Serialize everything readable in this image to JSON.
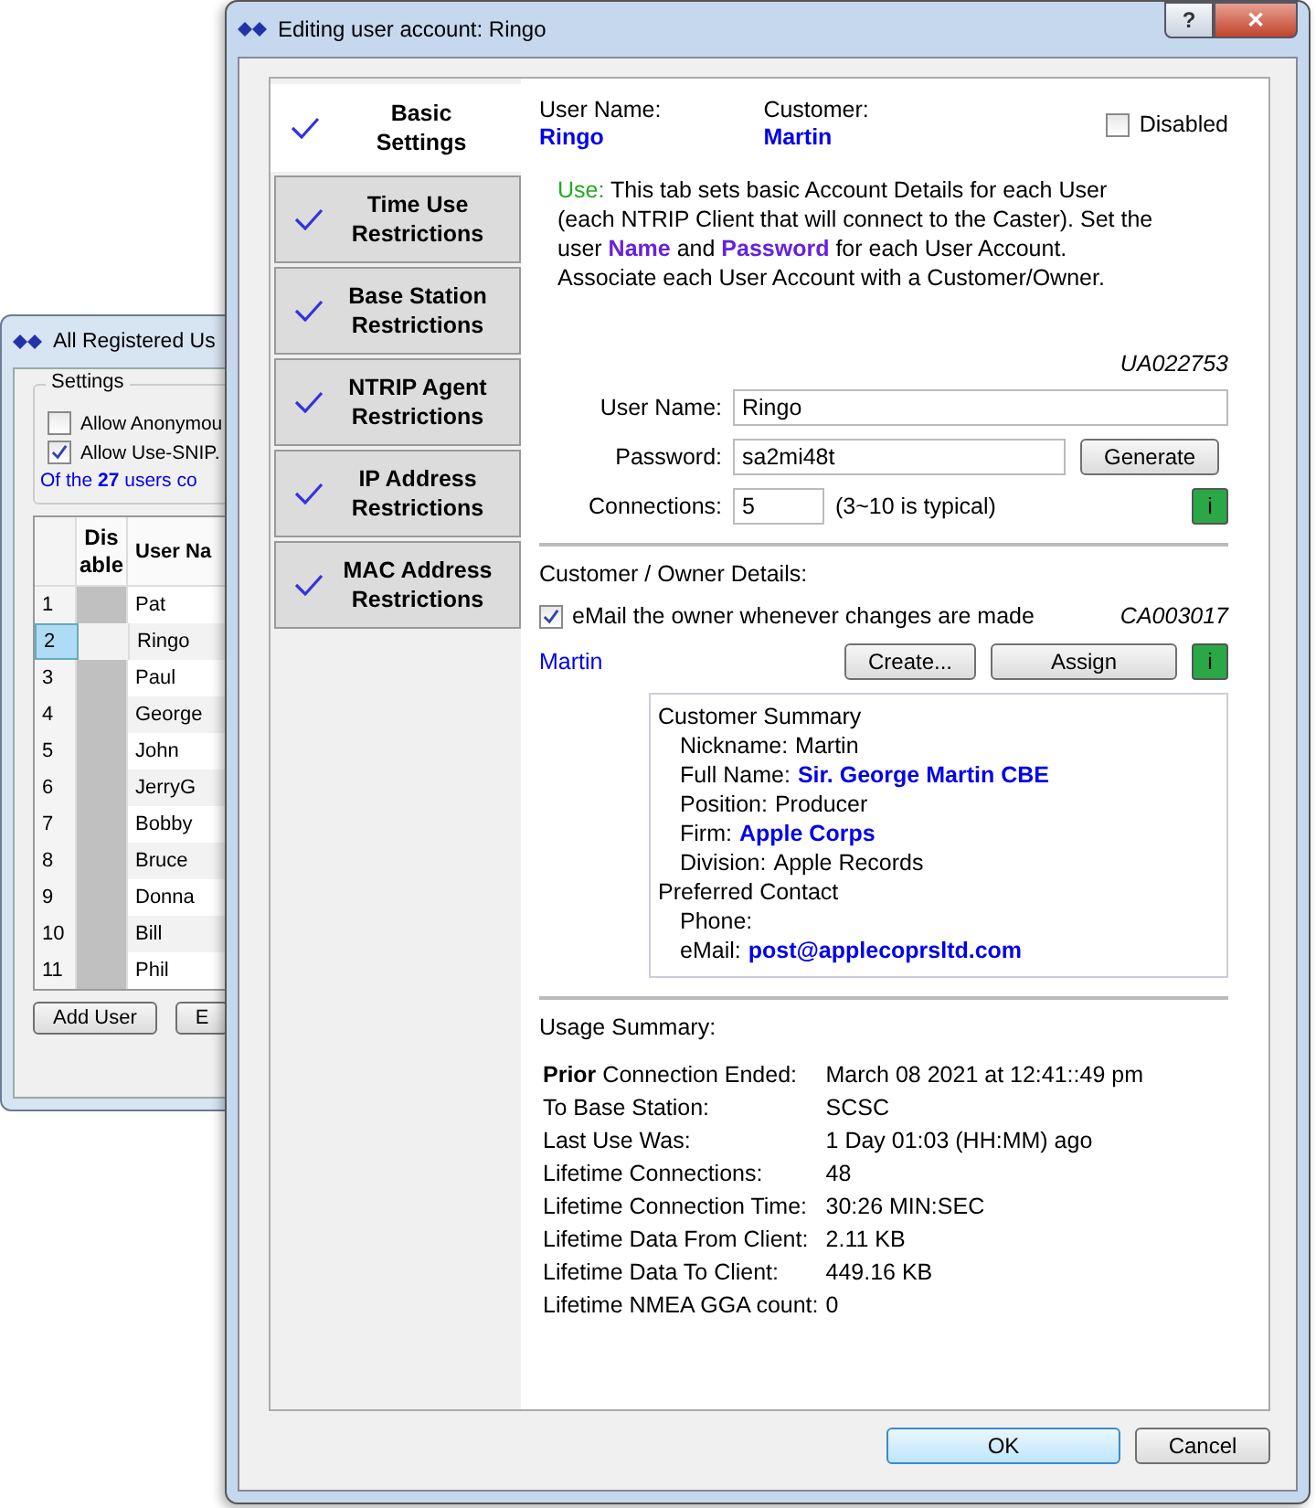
{
  "background_window": {
    "title": "All Registered Us",
    "settings": {
      "title": "Settings",
      "options": [
        {
          "label": "Allow Anonymou",
          "checked": false
        },
        {
          "label": "Allow Use-SNIP.",
          "checked": true
        }
      ],
      "note": "Of the **27** users co"
    },
    "table": {
      "columns": [
        "",
        "Dis able",
        "User Na"
      ],
      "rows": [
        {
          "number": "1",
          "name": "Pat",
          "selected": false
        },
        {
          "number": "2",
          "name": "Ringo",
          "selected": true
        },
        {
          "number": "3",
          "name": "Paul",
          "selected": false
        },
        {
          "number": "4",
          "name": "George",
          "selected": false
        },
        {
          "number": "5",
          "name": "John",
          "selected": false
        },
        {
          "number": "6",
          "name": "JerryG",
          "selected": false
        },
        {
          "number": "7",
          "name": "Bobby",
          "selected": false
        },
        {
          "number": "8",
          "name": "Bruce",
          "selected": false
        },
        {
          "number": "9",
          "name": "Donna",
          "selected": false
        },
        {
          "number": "10",
          "name": "Bill",
          "selected": false
        },
        {
          "number": "11",
          "name": "Phil",
          "selected": false
        }
      ]
    },
    "buttons": [
      "Add User",
      "E"
    ]
  },
  "dialog": {
    "title": "Editing user account: Ringo",
    "title_buttons": [
      "?",
      "✕"
    ],
    "tabs": [
      {
        "label": "Basic Settings",
        "selected": true,
        "checked": true
      },
      {
        "label": "Time Use Restrictions",
        "selected": false,
        "checked": true
      },
      {
        "label": "Base Station Restrictions",
        "selected": false,
        "checked": true
      },
      {
        "label": "NTRIP Agent Restrictions",
        "selected": false,
        "checked": true
      },
      {
        "label": "IP Address Restrictions",
        "selected": false,
        "checked": true
      },
      {
        "label": "MAC Address Restrictions",
        "selected": false,
        "checked": true
      }
    ],
    "header": [
      {
        "label": "User Name:",
        "value": "Ringo"
      },
      {
        "label": "Customer:",
        "value": "Martin"
      }
    ],
    "disabled": {
      "label": "Disabled",
      "checked": false
    },
    "intro": {
      "lead": "Use:",
      "text": "This tab sets basic Account Details for each User (each NTRIP Client that will connect to the Caster). Set the user **Name** and **Password** for each User Account. Associate each User Account with a Customer/Owner."
    },
    "account_id": "UA022753",
    "fields": [
      {
        "kind": "text",
        "label": "User Name:",
        "value": "Ringo"
      },
      {
        "kind": "password",
        "label": "Password:",
        "value": "sa2mi48t",
        "button": "Generate"
      },
      {
        "kind": "number",
        "label": "Connections:",
        "value": "5",
        "hint": "(3~10 is typical)",
        "info": "i"
      }
    ],
    "owner": {
      "title": "Customer / Owner Details:",
      "email_option": {
        "label": "eMail the owner whenever changes are made",
        "checked": true
      },
      "customer_id": "CA003017",
      "customer_link": "Martin",
      "buttons": [
        "Create...",
        "Assign"
      ],
      "info": "i",
      "summary": [
        {
          "title": "Customer Summary",
          "children": [
            {
              "label": "Nickname:",
              "value": "Martin",
              "emphasis": false
            },
            {
              "label": "Full Name:",
              "value": "Sir. George Martin CBE",
              "emphasis": true
            },
            {
              "label": "Position:",
              "value": "Producer",
              "emphasis": false
            },
            {
              "label": "Firm:",
              "value": "Apple Corps",
              "emphasis": true
            },
            {
              "label": "Division:",
              "value": "Apple Records",
              "emphasis": false
            }
          ]
        },
        {
          "title": "Preferred Contact",
          "children": [
            {
              "label": "Phone:"
            },
            {
              "label": "eMail:",
              "value": "post@applecoprsltd.com",
              "emphasis": true
            }
          ]
        }
      ]
    },
    "usage": {
      "title": "Usage Summary:",
      "rows": [
        {
          "label": "**Prior** Connection Ended:",
          "value": "March 08 2021 at 12:41::49 pm"
        },
        {
          "label": "To Base Station:",
          "value": "SCSC"
        },
        {
          "label": "Last Use Was:",
          "value": "1 Day 01:03 (HH:MM) ago"
        },
        {
          "label": "Lifetime Connections:",
          "value": "48"
        },
        {
          "label": "Lifetime Connection Time:",
          "value": "30:26 MIN:SEC"
        },
        {
          "label": "Lifetime Data From Client:",
          "value": "2.11 KB"
        },
        {
          "label": "Lifetime Data To Client:",
          "value": "449.16 KB"
        },
        {
          "label": "Lifetime NMEA GGA count:",
          "value": "0"
        }
      ]
    },
    "buttons": [
      {
        "label": "OK",
        "default": true
      },
      {
        "label": "Cancel",
        "default": false
      }
    ]
  }
}
